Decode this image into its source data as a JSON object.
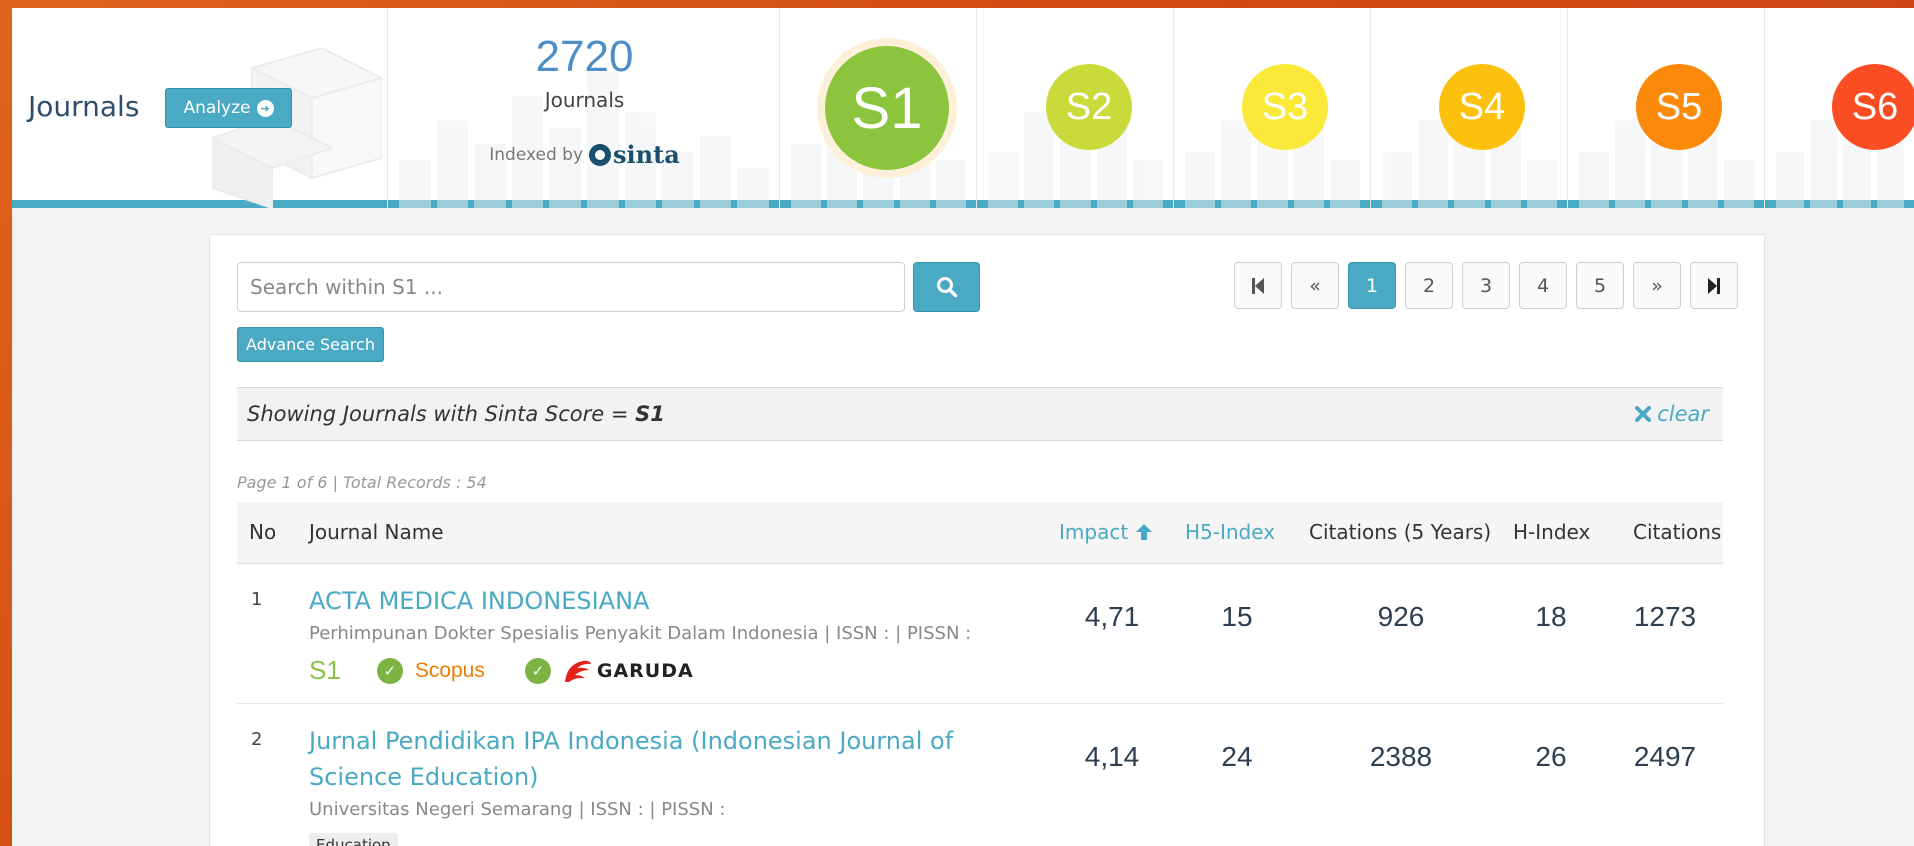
{
  "header": {
    "title": "Journals",
    "analyze_label": "Analyze",
    "total_count": "2720",
    "total_label": "Journals",
    "indexed_by": "Indexed by",
    "indexer_logo": "sinta",
    "grades": [
      {
        "label": "S1",
        "color": "#8cc43e"
      },
      {
        "label": "S2",
        "color": "#c8db3a"
      },
      {
        "label": "S3",
        "color": "#fbe93a"
      },
      {
        "label": "S4",
        "color": "#fcc10d"
      },
      {
        "label": "S5",
        "color": "#fb8a0b"
      },
      {
        "label": "S6",
        "color": "#fb4d23"
      }
    ]
  },
  "search": {
    "placeholder": "Search within S1 ...",
    "advance_label": "Advance Search"
  },
  "pagination": {
    "pages": [
      "1",
      "2",
      "3",
      "4",
      "5"
    ],
    "current": "1"
  },
  "filter": {
    "prefix": "Showing Journals with Sinta Score = ",
    "value": "S1",
    "clear_label": "clear"
  },
  "page_info": "Page 1 of 6 | Total Records : 54",
  "table": {
    "columns": {
      "no": "No",
      "name": "Journal Name",
      "impact": "Impact",
      "h5": "H5-Index",
      "cit5": "Citations (5 Years)",
      "hindex": "H-Index",
      "citations": "Citations"
    },
    "rows": [
      {
        "no": "1",
        "name": "ACTA MEDICA INDONESIANA",
        "publisher": "Perhimpunan Dokter Spesialis Penyakit Dalam Indonesia | ISSN : | PISSN :",
        "grade": "S1",
        "scopus": "Scopus",
        "garuda": "GARUDA",
        "impact": "4,71",
        "h5": "15",
        "cit5": "926",
        "hindex": "18",
        "citations": "1273"
      },
      {
        "no": "2",
        "name": "Jurnal Pendidikan IPA Indonesia (Indonesian Journal of Science Education)",
        "publisher": "Universitas Negeri Semarang | ISSN : | PISSN :",
        "subject": "Education",
        "impact": "4,14",
        "h5": "24",
        "cit5": "2388",
        "hindex": "26",
        "citations": "2497"
      }
    ]
  },
  "colors": {
    "accent": "#4aa9c3",
    "background_orange": "#d9531a"
  }
}
